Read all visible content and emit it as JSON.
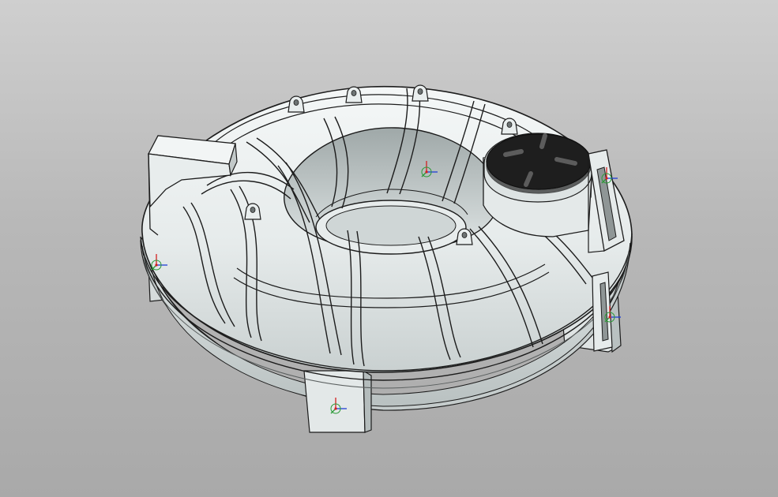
{
  "viewport": {
    "background_top": "#cfcfcf",
    "background_bottom": "#a9a9a9"
  },
  "model": {
    "part": "toroidal-tank",
    "body_color": "#e9eded",
    "shade_color": "#c8cfcf",
    "edge_color": "#1c1c1c",
    "cap_color": "#1e1e1e",
    "rib_count_outer": 12,
    "lifting_lug_count": 6,
    "support_foot_count": 4
  },
  "triads": {
    "x_axis_color": "#1f3fd6",
    "y_axis_color": "#2a9a36",
    "z_axis_color": "#d41f1f",
    "count": 5
  }
}
